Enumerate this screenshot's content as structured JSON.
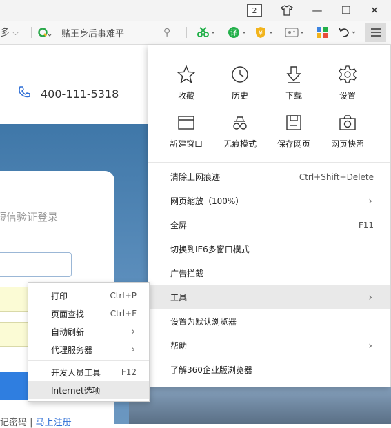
{
  "titlebar": {
    "tab_count": "2",
    "shirt_icon": "shirt-icon",
    "minimize_glyph": "—",
    "restore_glyph": "❐",
    "close_glyph": "✕"
  },
  "toolbar": {
    "left_fragment": "多",
    "search_placeholder": "赌王身后事难平",
    "dropdown_glyph": "⌵",
    "search_glyph": "⚲"
  },
  "page": {
    "phone": "400-111-5318",
    "login_title_fragment": "短信验证登录",
    "register_prefix": "记密码 | ",
    "register_link": "马上注册"
  },
  "menu": {
    "icons": [
      {
        "label": "收藏",
        "icon": "star-icon"
      },
      {
        "label": "历史",
        "icon": "clock-icon"
      },
      {
        "label": "下载",
        "icon": "download-icon"
      },
      {
        "label": "设置",
        "icon": "gear-icon"
      },
      {
        "label": "新建窗口",
        "icon": "window-icon"
      },
      {
        "label": "无痕模式",
        "icon": "incognito-icon"
      },
      {
        "label": "保存网页",
        "icon": "save-icon"
      },
      {
        "label": "网页快照",
        "icon": "camera-icon"
      }
    ],
    "items": [
      {
        "label": "清除上网痕迹",
        "shortcut": "Ctrl+Shift+Delete"
      },
      {
        "label": "网页缩放（100%）",
        "arrow": "›"
      },
      {
        "label": "全屏",
        "shortcut": "F11"
      },
      {
        "label": "切换到IE6多窗口模式"
      },
      {
        "label": "广告拦截"
      },
      {
        "label": "工具",
        "arrow": "›"
      },
      {
        "label": "设置为默认浏览器"
      },
      {
        "label": "帮助",
        "arrow": "›"
      },
      {
        "label": "了解360企业版浏览器"
      }
    ]
  },
  "submenu": {
    "items": [
      {
        "label": "打印",
        "shortcut": "Ctrl+P"
      },
      {
        "label": "页面查找",
        "shortcut": "Ctrl+F"
      },
      {
        "label": "自动刷新",
        "arrow": "›"
      },
      {
        "label": "代理服务器",
        "arrow": "›"
      },
      {
        "label": "开发人员工具",
        "shortcut": "F12"
      },
      {
        "label": "Internet选项"
      }
    ]
  },
  "colors": {
    "accent_green": "#23b04a",
    "shield_yellow": "#f2b41c",
    "link_blue": "#2f6fd6"
  }
}
